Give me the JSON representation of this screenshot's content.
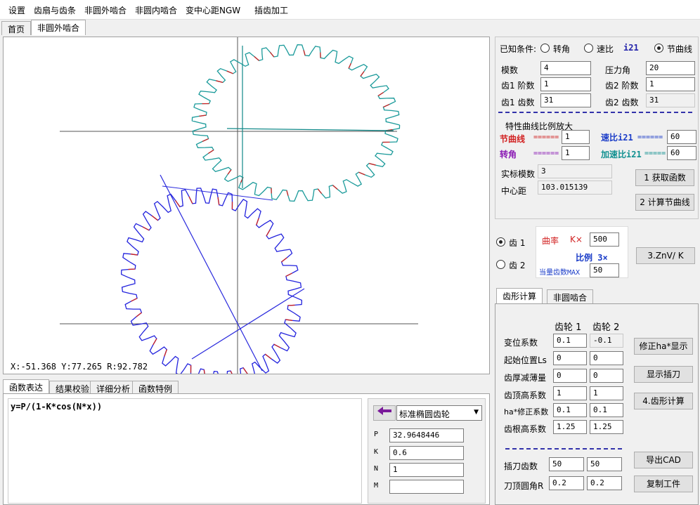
{
  "menu": [
    "设置",
    "齿扇与齿条",
    "非圆外啮合",
    "非圆内啮合",
    "变中心距NGW",
    "插齿加工"
  ],
  "tabs": [
    "首页",
    "非圆外啮合"
  ],
  "canvas": {
    "coords": "X:-51.368   Y:77.265    R:92.782"
  },
  "bottom_tabs": [
    "函数表达",
    "结果校验",
    "详细分析",
    "函数特例"
  ],
  "function": {
    "expression": "y=P/(1-K*cos(N*x))",
    "preset": "标准椭圆齿轮",
    "params": [
      {
        "name": "P",
        "value": "32.9648446"
      },
      {
        "name": "K",
        "value": "0.6"
      },
      {
        "name": "N",
        "value": "1"
      },
      {
        "name": "M",
        "value": ""
      }
    ]
  },
  "known": {
    "label": "已知条件:",
    "options": [
      "转角",
      "速比",
      "节曲线"
    ],
    "ratio_tag": "i21",
    "selected": 2
  },
  "params": {
    "module_label": "模数",
    "module": "4",
    "pressure_label": "压力角",
    "pressure": "20",
    "g1order_label": "齿1 阶数",
    "g1order": "1",
    "g2order_label": "齿2 阶数",
    "g2order": "1",
    "g1teeth_label": "齿1 齿数",
    "g1teeth": "31",
    "g2teeth_label": "齿2 齿数",
    "g2teeth": "31"
  },
  "scale": {
    "title": "特性曲线比例放大",
    "pitch_label": "节曲线",
    "pitch_eq": "======",
    "pitch": "1",
    "ratio_label": "速比i21",
    "ratio_eq": "======",
    "ratio": "60",
    "angle_label": "转角",
    "angle_eq": "======",
    "angle": "1",
    "accel_label": "加速比i21",
    "accel_eq": "=====",
    "accel": "60"
  },
  "results": {
    "actual_module_label": "实标模数",
    "actual_module": "3",
    "center_label": "中心距",
    "center": "103.015139",
    "btn_get": "1 获取函数",
    "btn_pitch": "2 计算节曲线"
  },
  "curvature": {
    "gear1": "齿 1",
    "gear2": "齿 2",
    "curv_label": "曲率",
    "k_label": "K×",
    "k": "500",
    "ratio_label": "比例 3×",
    "max_label": "当量齿数MAX",
    "max": "50",
    "btn": "3.ZnV/ K"
  },
  "tooth_tabs": [
    "齿形计算",
    "非圆啮合"
  ],
  "tooth": {
    "col1": "齿轮 1",
    "col2": "齿轮 2",
    "rows": [
      {
        "label": "变位系数",
        "v1": "0.1",
        "v2": "-0.1"
      },
      {
        "label": "起始位置Ls",
        "v1": "0",
        "v2": "0"
      },
      {
        "label": "齿厚减薄量",
        "v1": "0",
        "v2": "0"
      },
      {
        "label": "齿顶高系数",
        "v1": "1",
        "v2": "1"
      },
      {
        "label": "ha*修正系数",
        "v1": "0.1",
        "v2": "0.1"
      },
      {
        "label": "齿根高系数",
        "v1": "1.25",
        "v2": "1.25"
      }
    ],
    "cutter_teeth_label": "插刀齿数",
    "ct1": "50",
    "ct2": "50",
    "cutter_r_label": "刀顶圆角R",
    "cr1": "0.2",
    "cr2": "0.2",
    "btn_ha": "修正ha*显示",
    "btn_show": "显示插刀",
    "btn_calc": "4.齿形计算",
    "btn_cad": "导出CAD",
    "btn_copy": "复制工件"
  }
}
